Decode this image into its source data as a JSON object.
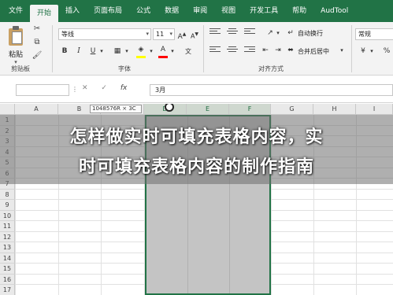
{
  "ribbon_tabs": [
    "文件",
    "开始",
    "插入",
    "页面布局",
    "公式",
    "数据",
    "审阅",
    "视图",
    "开发工具",
    "帮助",
    "AudTool"
  ],
  "active_tab": "开始",
  "clipboard": {
    "paste_label": "粘贴",
    "group_label": "剪贴板"
  },
  "font": {
    "name": "等线",
    "size": "11",
    "bold": "B",
    "italic": "I",
    "underline": "U",
    "group_label": "字体",
    "fill_color": "#ffff00",
    "font_color": "#ff0000"
  },
  "alignment": {
    "wrap_label": "自动换行",
    "merge_label": "合并后居中",
    "group_label": "对齐方式"
  },
  "number": {
    "format": "常规"
  },
  "formula_bar": {
    "name_box": "",
    "cancel_icon": "✕",
    "enter_icon": "✓",
    "fx_label": "fx",
    "value": "3月"
  },
  "grid": {
    "columns": [
      "A",
      "B",
      "C",
      "D",
      "E",
      "F",
      "G",
      "H",
      "I"
    ],
    "rows": [
      "1",
      "2",
      "3",
      "4",
      "5",
      "6",
      "7",
      "8",
      "9",
      "10",
      "11",
      "12",
      "13",
      "14",
      "15",
      "16",
      "17"
    ],
    "tooltip": "1048576R × 3C"
  },
  "overlay": {
    "line1": "怎样做实时可填充表格内容，实",
    "line2": "时可填充表格内容的制作指南"
  },
  "colors": {
    "excel_green": "#217346"
  }
}
